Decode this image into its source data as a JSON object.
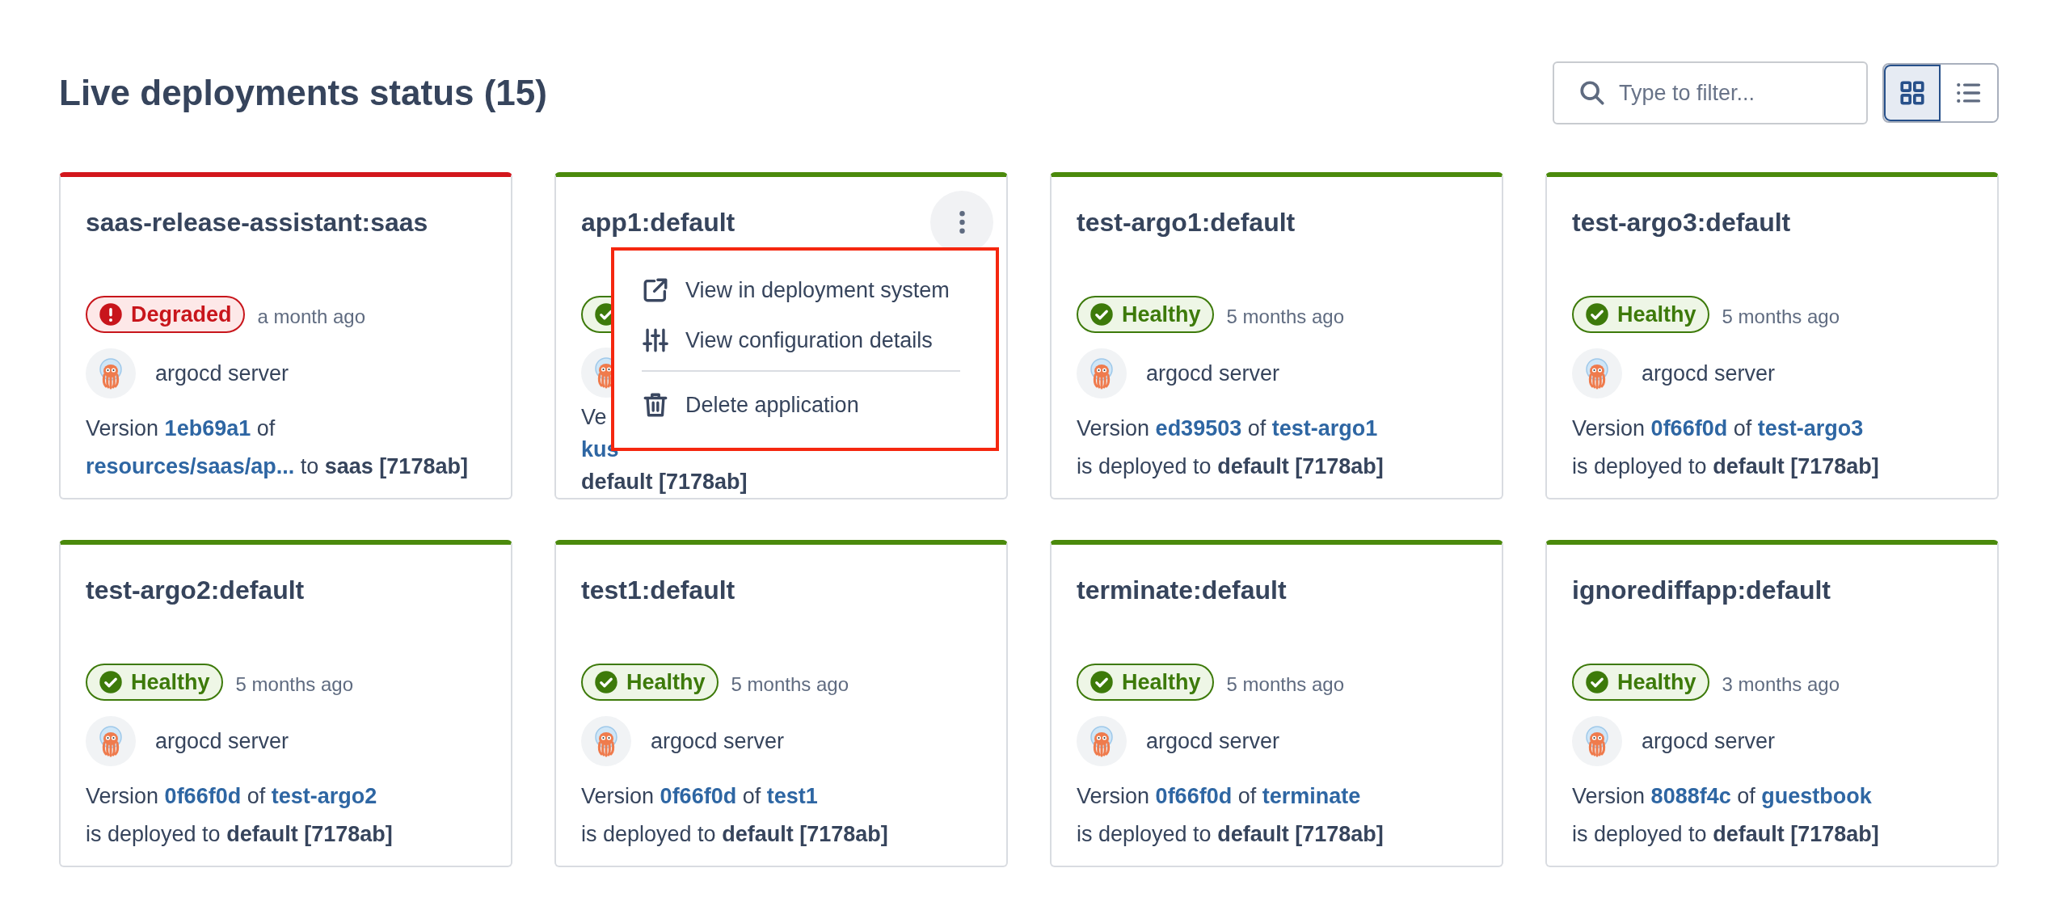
{
  "header": {
    "title": "Live deployments status (15)",
    "filter": {
      "placeholder": "Type to filter..."
    },
    "views": [
      {
        "kind": "grid",
        "selected": true
      },
      {
        "kind": "list",
        "selected": false
      }
    ]
  },
  "cards": [
    {
      "title": "saas-release-assistant:saas",
      "status": {
        "kind": "degraded",
        "label": "Degraded"
      },
      "time": "a month ago",
      "owner": "argocd server",
      "lines": [
        [
          {
            "kind": "text",
            "text": "Version"
          },
          {
            "kind": "link",
            "text": "1eb69a1"
          },
          {
            "kind": "text",
            "text": "of"
          }
        ],
        [
          {
            "kind": "link",
            "text": "resources/saas/ap..."
          },
          {
            "kind": "text",
            "text": "to"
          },
          {
            "kind": "bold",
            "text": "saas [7178ab]"
          }
        ]
      ]
    },
    {
      "title": "app1:default",
      "status": {
        "kind": "healthy"
      },
      "lines": [
        [
          {
            "kind": "text",
            "text": "Ve"
          }
        ],
        [
          {
            "kind": "link",
            "text": "kus"
          }
        ],
        [
          {
            "kind": "bold",
            "text": "default [7178ab]"
          }
        ]
      ],
      "menu": [
        {
          "kind": "external",
          "label": "View in deployment system"
        },
        {
          "kind": "sliders",
          "label": "View configuration details"
        },
        {
          "kind": "divider"
        },
        {
          "kind": "trash",
          "label": "Delete application"
        }
      ]
    },
    {
      "title": "test-argo1:default",
      "status": {
        "kind": "healthy",
        "label": "Healthy"
      },
      "time": "5 months ago",
      "owner": "argocd server",
      "lines": [
        [
          {
            "kind": "text",
            "text": "Version"
          },
          {
            "kind": "link",
            "text": "ed39503"
          },
          {
            "kind": "text",
            "text": "of"
          },
          {
            "kind": "link",
            "text": "test-argo1"
          }
        ],
        [
          {
            "kind": "text",
            "text": "is deployed to"
          },
          {
            "kind": "bold",
            "text": "default [7178ab]"
          }
        ]
      ]
    },
    {
      "title": "test-argo3:default",
      "status": {
        "kind": "healthy",
        "label": "Healthy"
      },
      "time": "5 months ago",
      "owner": "argocd server",
      "lines": [
        [
          {
            "kind": "text",
            "text": "Version"
          },
          {
            "kind": "link",
            "text": "0f66f0d"
          },
          {
            "kind": "text",
            "text": "of"
          },
          {
            "kind": "link",
            "text": "test-argo3"
          }
        ],
        [
          {
            "kind": "text",
            "text": "is deployed to"
          },
          {
            "kind": "bold",
            "text": "default [7178ab]"
          }
        ]
      ]
    },
    {
      "title": "test-argo2:default",
      "status": {
        "kind": "healthy",
        "label": "Healthy"
      },
      "time": "5 months ago",
      "owner": "argocd server",
      "lines": [
        [
          {
            "kind": "text",
            "text": "Version"
          },
          {
            "kind": "link",
            "text": "0f66f0d"
          },
          {
            "kind": "text",
            "text": "of"
          },
          {
            "kind": "link",
            "text": "test-argo2"
          }
        ],
        [
          {
            "kind": "text",
            "text": "is deployed to"
          },
          {
            "kind": "bold",
            "text": "default [7178ab]"
          }
        ]
      ]
    },
    {
      "title": "test1:default",
      "status": {
        "kind": "healthy",
        "label": "Healthy"
      },
      "time": "5 months ago",
      "owner": "argocd server",
      "lines": [
        [
          {
            "kind": "text",
            "text": "Version"
          },
          {
            "kind": "link",
            "text": "0f66f0d"
          },
          {
            "kind": "text",
            "text": "of"
          },
          {
            "kind": "link",
            "text": "test1"
          }
        ],
        [
          {
            "kind": "text",
            "text": "is deployed to"
          },
          {
            "kind": "bold",
            "text": "default [7178ab]"
          }
        ]
      ]
    },
    {
      "title": "terminate:default",
      "status": {
        "kind": "healthy",
        "label": "Healthy"
      },
      "time": "5 months ago",
      "owner": "argocd server",
      "lines": [
        [
          {
            "kind": "text",
            "text": "Version"
          },
          {
            "kind": "link",
            "text": "0f66f0d"
          },
          {
            "kind": "text",
            "text": "of"
          },
          {
            "kind": "link",
            "text": "terminate"
          }
        ],
        [
          {
            "kind": "text",
            "text": "is deployed to"
          },
          {
            "kind": "bold",
            "text": "default [7178ab]"
          }
        ]
      ]
    },
    {
      "title": "ignorediffapp:default",
      "status": {
        "kind": "healthy",
        "label": "Healthy"
      },
      "time": "3 months ago",
      "owner": "argocd server",
      "lines": [
        [
          {
            "kind": "text",
            "text": "Version"
          },
          {
            "kind": "link",
            "text": "8088f4c"
          },
          {
            "kind": "text",
            "text": "of"
          },
          {
            "kind": "link",
            "text": "guestbook"
          }
        ],
        [
          {
            "kind": "text",
            "text": "is deployed to"
          },
          {
            "kind": "bold",
            "text": "default [7178ab]"
          }
        ]
      ]
    }
  ]
}
